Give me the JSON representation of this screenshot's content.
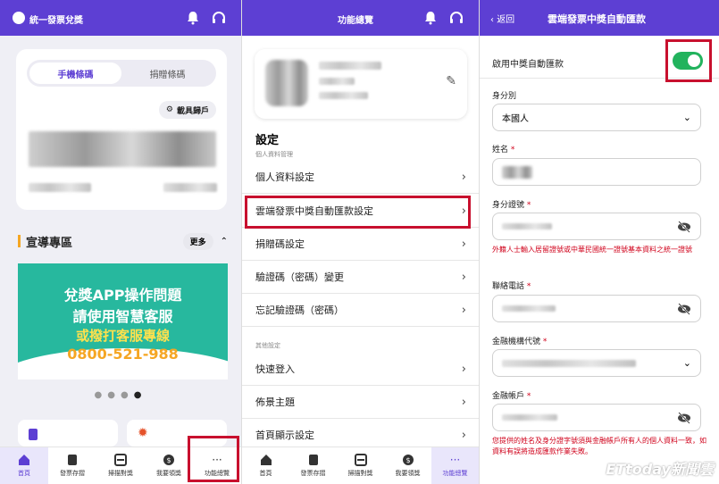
{
  "panel1": {
    "app_title": "統一發票兌獎",
    "tabs": [
      "手機條碼",
      "捐贈條碼"
    ],
    "carrier_button": "載具歸戶",
    "section_title": "宣導專區",
    "more_button": "更多",
    "banner": {
      "line1": "兌獎APP操作問題",
      "line2": "請使用智慧客服",
      "line3": "或撥打客服專線",
      "line4": "0800-521-988"
    }
  },
  "bottom_nav": [
    "首頁",
    "發票存摺",
    "掃描對獎",
    "我要領獎",
    "功能總覽"
  ],
  "panel2": {
    "title": "功能總覽",
    "settings_title": "設定",
    "personal_section": "個人資料管理",
    "items_personal": [
      "個人資料設定",
      "雲端發票中獎自動匯款設定",
      "捐贈碼設定",
      "驗證碼（密碼）變更",
      "忘記驗證碼（密碼）"
    ],
    "other_section": "其他設定",
    "items_other": [
      "快速登入",
      "佈景主題",
      "首頁顯示設定"
    ]
  },
  "panel3": {
    "back_label": "返回",
    "title": "雲端發票中獎自動匯款",
    "enable_label": "啟用中獎自動匯款",
    "enabled": true,
    "identity_label": "身分別",
    "identity_value": "本國人",
    "name_label": "姓名",
    "id_label": "身分證號",
    "id_note": "外籍人士輸入居留證號或中華民國統一證號基本資料之統一證號",
    "phone_label": "聯絡電話",
    "bank_label": "金融機構代號",
    "account_label": "金融帳戶",
    "account_note": "您提供的姓名及身分證字號須與金融帳戶所有人的個人資料一致，如資料有誤將造成匯款作業失敗。",
    "required_mark": "*"
  },
  "watermark": "ETtoday新聞雲",
  "colors": {
    "brand": "#5d3fd3",
    "toggle_on": "#22b35d",
    "highlight": "#c8102e",
    "banner": "#27b89e"
  }
}
